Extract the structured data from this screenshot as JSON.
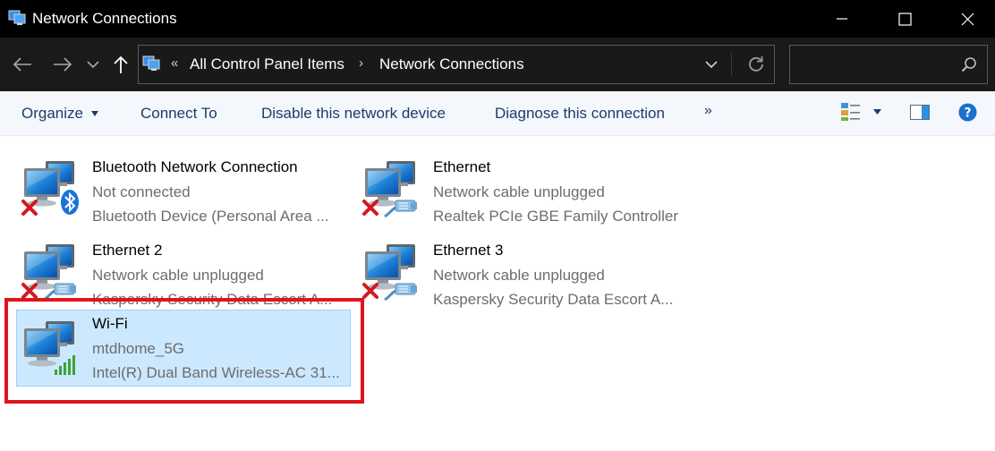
{
  "window": {
    "title": "Network Connections"
  },
  "icons": {
    "app": "network-connections-icon",
    "minimize": "minimize-icon",
    "maximize": "maximize-icon",
    "close": "close-icon",
    "back": "back-arrow-icon",
    "forward": "forward-arrow-icon",
    "recent": "chevron-down-icon",
    "up": "up-arrow-icon",
    "refresh": "refresh-icon",
    "search": "search-icon",
    "view": "change-view-icon",
    "preview_pane": "preview-pane-icon",
    "help": "help-icon",
    "bluetooth": "bluetooth-icon",
    "disconnected": "red-x-icon",
    "cable": "network-cable-icon",
    "signal": "wifi-signal-icon"
  },
  "address": {
    "overflow": "«",
    "crumbs": [
      "All Control Panel Items",
      "Network Connections"
    ],
    "separator": "›",
    "search_placeholder": ""
  },
  "toolbar": {
    "organize": "Organize",
    "connect": "Connect To",
    "disable": "Disable this network device",
    "diagnose": "Diagnose this connection",
    "more": "»"
  },
  "items": [
    {
      "name": "Bluetooth Network Connection",
      "status": "Not connected",
      "device": "Bluetooth Device (Personal Area ..."
    },
    {
      "name": "Ethernet",
      "status": "Network cable unplugged",
      "device": "Realtek PCIe GBE Family Controller"
    },
    {
      "name": "Ethernet 2",
      "status": "Network cable unplugged",
      "device": "Kaspersky Security Data Escort A..."
    },
    {
      "name": "Ethernet 3",
      "status": "Network cable unplugged",
      "device": "Kaspersky Security Data Escort A..."
    },
    {
      "name": "Wi-Fi",
      "status": "mtdhome_5G",
      "device": "Intel(R) Dual Band Wireless-AC 31..."
    }
  ],
  "colors": {
    "titlebar": "#000000",
    "selection": "#cce8ff",
    "highlight": "#e0141e",
    "toolbar_text": "#1b3c6a"
  }
}
